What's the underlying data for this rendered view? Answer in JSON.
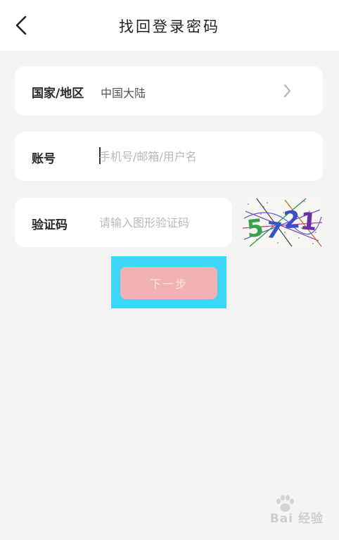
{
  "header": {
    "title": "找回登录密码",
    "back_icon": "chevron-left-icon"
  },
  "form": {
    "region": {
      "label": "国家/地区",
      "value": "中国大陆",
      "icon": "chevron-right-icon"
    },
    "account": {
      "label": "账号",
      "placeholder": "手机号/邮箱/用户名",
      "value": ""
    },
    "captcha": {
      "label": "验证码",
      "placeholder": "请输入图形验证码",
      "value": "",
      "image_text": "5721"
    },
    "next_label": "下一步"
  },
  "colors": {
    "highlight": "#3fd5f6",
    "next_button_bg": "#f2b2b3",
    "next_button_text": "#fbe3e3",
    "page_bg": "#f4f4f4"
  },
  "watermark": {
    "text": "Bai 经验",
    "icon": "paw-icon"
  }
}
